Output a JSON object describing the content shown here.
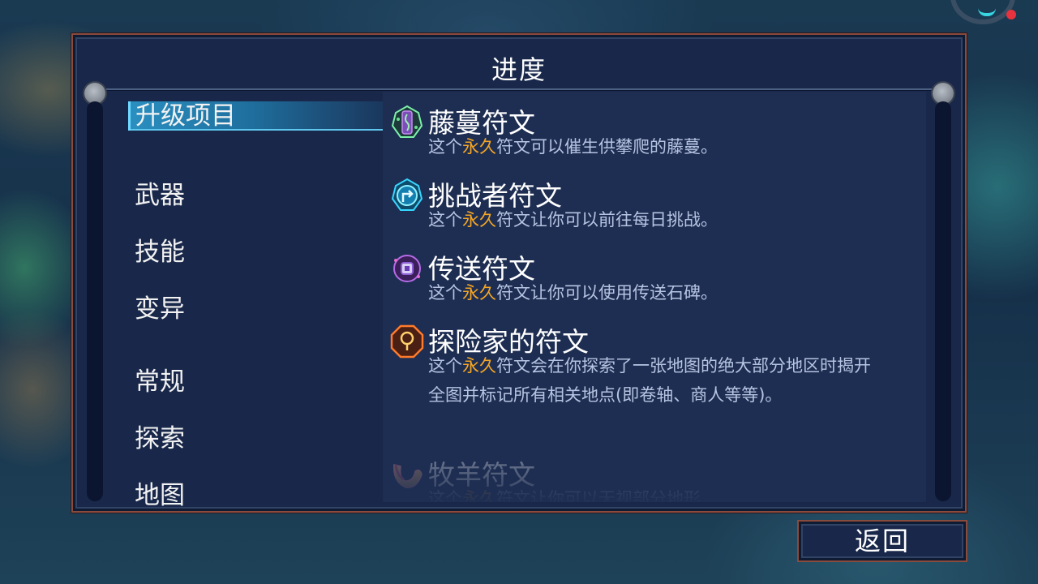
{
  "panel": {
    "title": "进度"
  },
  "categories": [
    {
      "label": "升级项目",
      "active": true
    },
    {
      "label": "武器"
    },
    {
      "label": "技能"
    },
    {
      "label": "变异"
    },
    {
      "label": "常规"
    },
    {
      "label": "探索"
    },
    {
      "label": "地图"
    }
  ],
  "items": [
    {
      "name": "藤蔓符文",
      "desc_pre": "这个",
      "desc_hl": "永久",
      "desc_post": "符文可以催生供攀爬的藤蔓。",
      "icon": "vine-rune-icon"
    },
    {
      "name": "挑战者符文",
      "desc_pre": "这个",
      "desc_hl": "永久",
      "desc_post": "符文让你可以前往每日挑战。",
      "icon": "challenger-rune-icon"
    },
    {
      "name": "传送符文",
      "desc_pre": "这个",
      "desc_hl": "永久",
      "desc_post": "符文让你可以使用传送石碑。",
      "icon": "teleport-rune-icon"
    },
    {
      "name": "探险家的符文",
      "desc_pre": "这个",
      "desc_hl": "永久",
      "desc_post": "符文会在你探索了一张地图的绝大部分地区时揭开全图并标记所有相关地点(即卷轴、商人等等)。",
      "icon": "explorer-rune-icon"
    },
    {
      "name": "牧羊符文",
      "desc_pre": "这个",
      "desc_hl": "永久",
      "desc_post": "符文让你可以无视部分地形",
      "icon": "ram-rune-icon"
    }
  ],
  "back_button": {
    "label": "返回"
  },
  "colors": {
    "highlight": "#f5a623",
    "panel_bg": "#19284a",
    "frame": "#8a4a3c",
    "active_tab": "#2a8fc0"
  }
}
